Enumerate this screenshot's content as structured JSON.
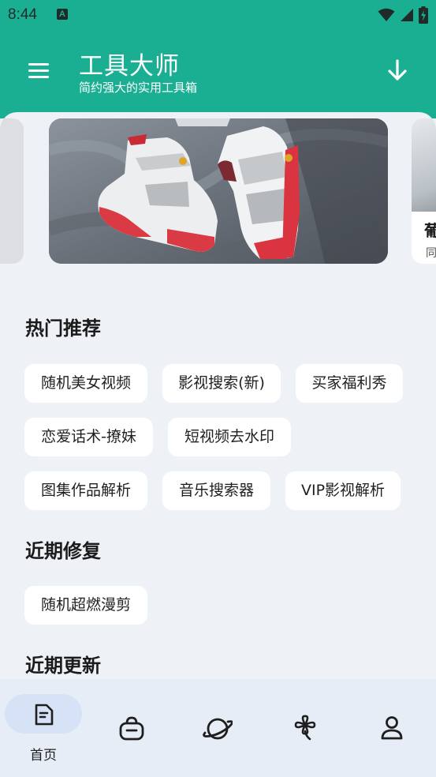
{
  "status_bar": {
    "time": "8:44",
    "notification_icon": "a-notification-icon",
    "icons": [
      "wifi-icon",
      "cell-signal-icon",
      "battery-charging-icon"
    ]
  },
  "header": {
    "title": "工具大师",
    "subtitle": "简约强大的实用工具箱",
    "menu_icon": "menu-icon",
    "action_icon": "download-icon"
  },
  "banner": {
    "next_title": "葡",
    "next_sub": "同"
  },
  "sections": {
    "hot": {
      "title": "热门推荐",
      "items": [
        "随机美女视频",
        "影视搜索(新)",
        "买家福利秀",
        "恋爱话术-撩妹",
        "短视频去水印",
        "图集作品解析",
        "音乐搜索器",
        "VIP影视解析"
      ]
    },
    "fixed": {
      "title": "近期修复",
      "items": [
        "随机超燃漫剪"
      ]
    },
    "updated": {
      "title": "近期更新"
    }
  },
  "bottom_nav": {
    "items": [
      {
        "icon": "document-icon",
        "label": "首页",
        "active": true
      },
      {
        "icon": "briefcase-icon",
        "label": ""
      },
      {
        "icon": "planet-icon",
        "label": ""
      },
      {
        "icon": "clover-icon",
        "label": ""
      },
      {
        "icon": "user-icon",
        "label": ""
      }
    ]
  },
  "colors": {
    "primary": "#1aaf93",
    "background": "#eef2f7",
    "nav_background": "#e7edf6",
    "nav_active_pill": "#d6e3f7"
  }
}
